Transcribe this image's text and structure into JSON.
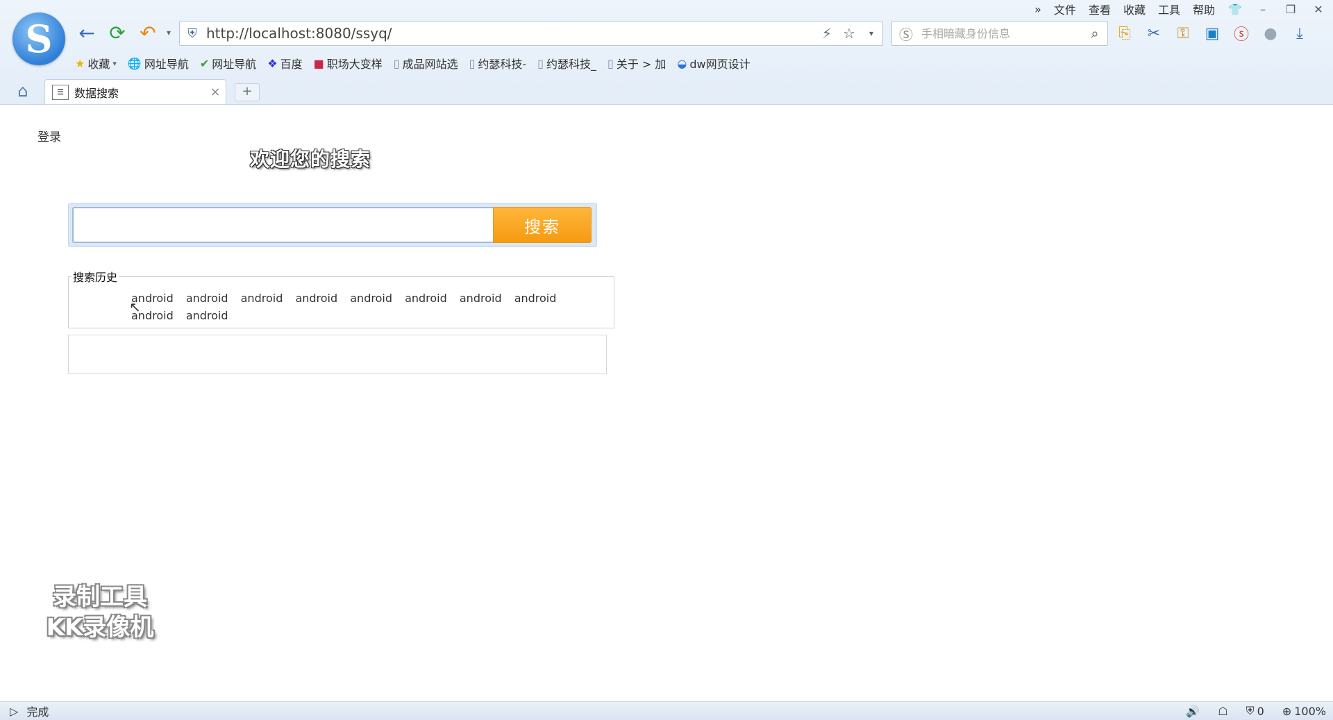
{
  "browser": {
    "menu": [
      "文件",
      "查看",
      "收藏",
      "工具",
      "帮助"
    ],
    "more_icon": "»",
    "url": "http://localhost:8080/ssyq/",
    "search_placeholder": "手相暗藏身份信息",
    "bookmarks": [
      {
        "icon": "star-icon",
        "label": "收藏"
      },
      {
        "icon": "globe-icon",
        "label": "网址导航"
      },
      {
        "icon": "hao-icon",
        "label": "网址导航"
      },
      {
        "icon": "baidu-icon",
        "label": "百度"
      },
      {
        "icon": "app-icon",
        "label": "职场大变样"
      },
      {
        "icon": "page-icon",
        "label": "成品网站选"
      },
      {
        "icon": "page-icon",
        "label": "约瑟科技-"
      },
      {
        "icon": "page-icon",
        "label": "约瑟科技_"
      },
      {
        "icon": "page-icon",
        "label": "关于 > 加"
      },
      {
        "icon": "dw-icon",
        "label": "dw网页设计"
      }
    ],
    "tab_title": "数据搜索",
    "status_text": "完成",
    "status_count": "0",
    "zoom": "100%"
  },
  "page": {
    "login": "登录",
    "welcome": "欢迎您的搜索",
    "search_value": "",
    "search_button": "搜索",
    "history_title": "搜索历史",
    "history_items": [
      "android",
      "android",
      "android",
      "android",
      "android",
      "android",
      "android",
      "android",
      "android",
      "android"
    ]
  },
  "watermark": {
    "line1": "录制工具",
    "line2": "KK录像机"
  },
  "colors": {
    "accent_orange": "#f59a11",
    "chrome_blue": "#e3edf8"
  }
}
